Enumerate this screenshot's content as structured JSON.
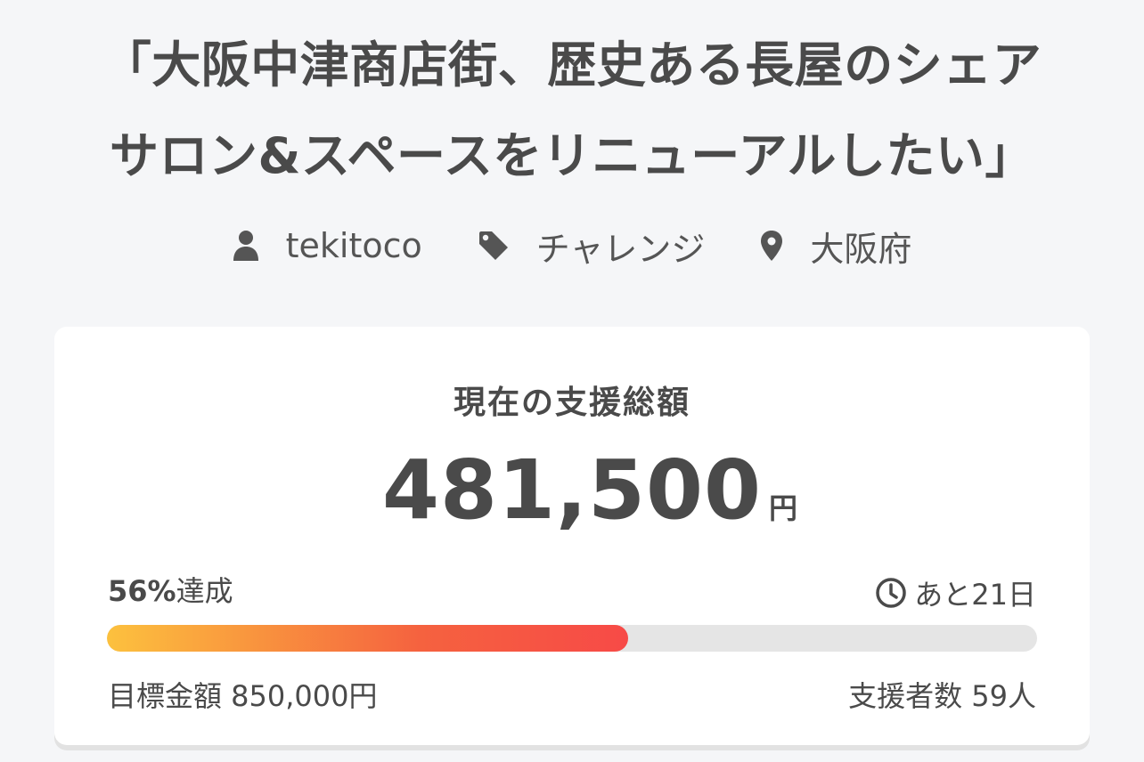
{
  "project": {
    "title_line1": "「大阪中津商店街、歴史ある長屋のシェア",
    "title_line2": "サロン&スペースをリニューアルしたい」"
  },
  "meta": {
    "owner": "tekitoco",
    "owner_icon": "user-icon",
    "category": "チャレンジ",
    "category_icon": "tag-icon",
    "location": "大阪府",
    "location_icon": "map-pin-icon"
  },
  "funding": {
    "heading": "現在の支援総額",
    "amount": "481,500",
    "amount_unit": "円",
    "percent_number": "56%",
    "percent_suffix": "達成",
    "progress_fraction": 0.56,
    "remaining": "あと21日",
    "remaining_icon": "clock-icon",
    "goal": "目標金額 850,000円",
    "backers": "支援者数 59人"
  },
  "colors": {
    "background": "#f5f6f8",
    "card": "#ffffff",
    "text": "#4a4a4a",
    "progress_start": "#fcc13e",
    "progress_end": "#f74a47",
    "track": "#e5e5e5"
  }
}
